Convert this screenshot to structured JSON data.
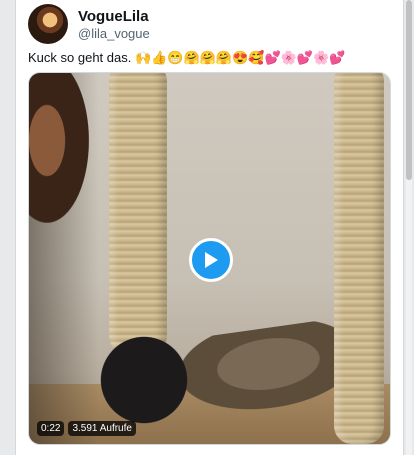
{
  "author": {
    "name": "VogueLila",
    "handle": "@lila_vogue"
  },
  "tweet": {
    "text": "Kuck so geht das. 🙌👍😁🤗🤗🤗😍🥰💕🌸💕🌸💕"
  },
  "video": {
    "duration": "0:22",
    "views": "3.591 Aufrufe",
    "play_icon": "play-icon"
  },
  "colors": {
    "accent": "#1d9bf0",
    "text_primary": "#0f1419",
    "text_secondary": "#536471"
  }
}
